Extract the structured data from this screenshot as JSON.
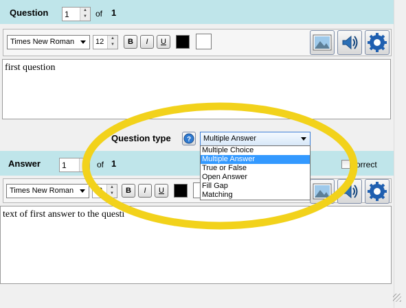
{
  "question": {
    "title": "Question",
    "number": "1",
    "of_label": "of",
    "total": "1",
    "font_name": "Times New Roman",
    "font_size": "12",
    "bold": "B",
    "italic": "I",
    "underline": "U",
    "text": "first question"
  },
  "question_type": {
    "label": "Question type",
    "selected": "Multiple Answer",
    "options": [
      "Multiple Choice",
      "Multiple Answer",
      "True or False",
      "Open Answer",
      "Fill Gap",
      "Matching"
    ],
    "selected_index": 1
  },
  "answer": {
    "title": "Answer",
    "number": "1",
    "of_label": "of",
    "total": "1",
    "correct_label": "orrect",
    "font_name": "Times New Roman",
    "font_size": "2",
    "bold": "B",
    "italic": "I",
    "underline": "U",
    "text": "text of first answer to the questi"
  },
  "colors": {
    "header_band": "#bfe5ea",
    "highlight_ellipse": "#f2d21b",
    "selection": "#3399ff"
  },
  "icons": [
    "image-icon",
    "sound-icon",
    "settings-icon",
    "help-icon"
  ]
}
